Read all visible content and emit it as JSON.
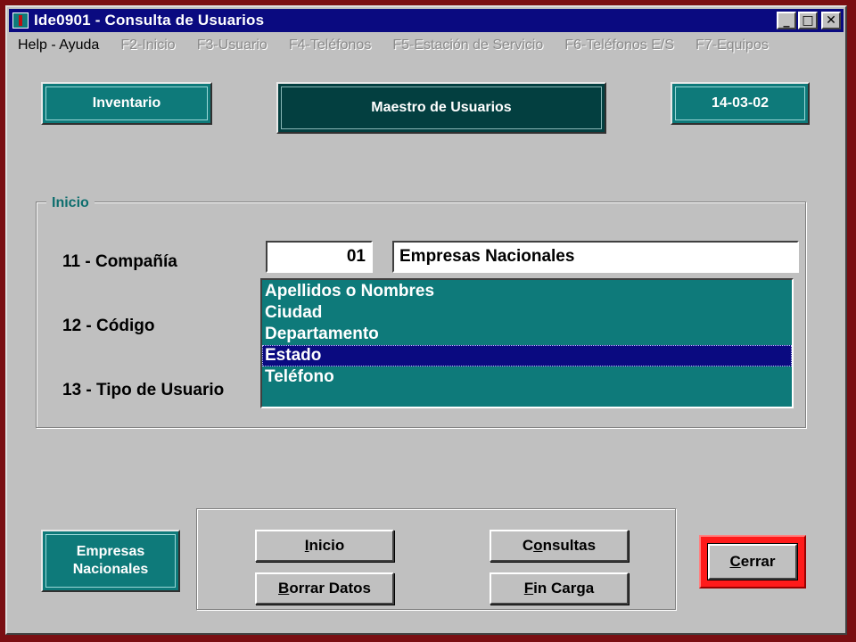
{
  "window": {
    "title": "Ide0901 - Consulta de Usuarios",
    "min_glyph": "_",
    "max_glyph": "□",
    "close_glyph": "✕",
    "icons": {
      "app": "app-icon",
      "minimize": "minimize-icon",
      "maximize": "maximize-icon",
      "close": "close-icon"
    }
  },
  "menu": [
    {
      "label": "Help - Ayuda",
      "enabled": true
    },
    {
      "label": "F2-Inicio",
      "enabled": false
    },
    {
      "label": "F3-Usuario",
      "enabled": false
    },
    {
      "label": "F4-Teléfonos",
      "enabled": false
    },
    {
      "label": "F5-Estación de Servicio",
      "enabled": false
    },
    {
      "label": "F6-Teléfonos E/S",
      "enabled": false
    },
    {
      "label": "F7-Equipos",
      "enabled": false
    }
  ],
  "header": {
    "left_button": "Inventario",
    "center_title": "Maestro de Usuarios",
    "date": "14-03-02"
  },
  "group": {
    "legend": "Inicio",
    "labels": [
      "11 - Compañía",
      "12 - Código",
      "13 - Tipo de Usuario"
    ],
    "company_code": "01",
    "company_name": "Empresas Nacionales",
    "list": [
      {
        "label": "Apellidos o Nombres",
        "selected": false
      },
      {
        "label": "Ciudad",
        "selected": false
      },
      {
        "label": "Departamento",
        "selected": false
      },
      {
        "label": "Estado",
        "selected": true
      },
      {
        "label": "Teléfono",
        "selected": false
      }
    ]
  },
  "footer": {
    "company_line1": "Empresas",
    "company_line2": "Nacionales",
    "buttons": {
      "inicio": {
        "pre": "",
        "ul": "I",
        "post": "nicio"
      },
      "consultas": {
        "pre": "C",
        "ul": "o",
        "post": "nsultas"
      },
      "borrar": {
        "pre": "",
        "ul": "B",
        "post": "orrar Datos"
      },
      "fin": {
        "pre": "",
        "ul": "F",
        "post": "in Carga"
      },
      "cerrar": {
        "pre": "",
        "ul": "C",
        "post": "errar"
      }
    }
  },
  "colors": {
    "teal": "#0e7a7a",
    "dark_teal": "#033f40",
    "title_blue": "#0a0a80",
    "close_red": "#ff1a1a"
  }
}
